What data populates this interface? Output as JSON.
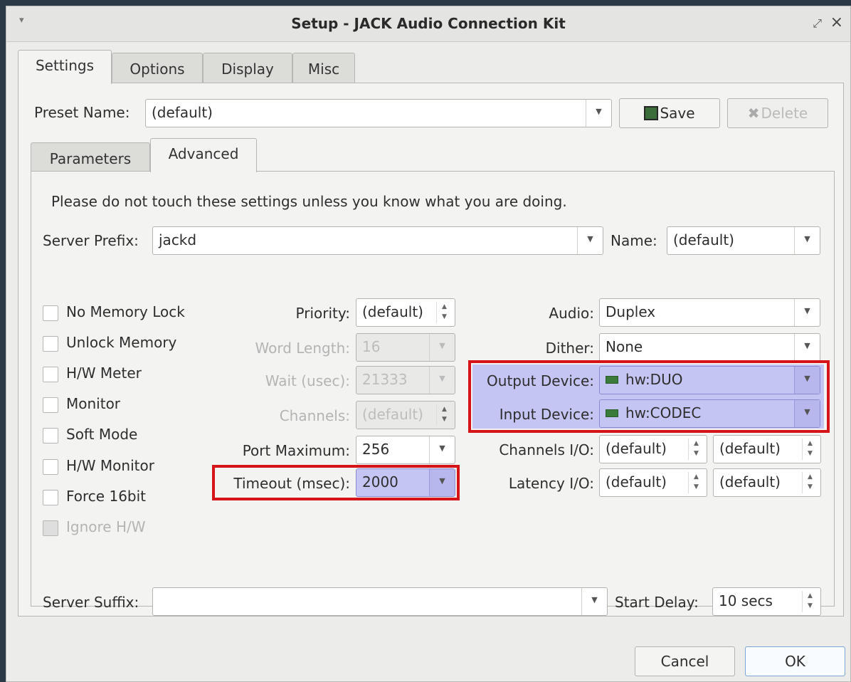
{
  "window": {
    "title": "Setup - JACK Audio Connection Kit"
  },
  "main_tabs": [
    "Settings",
    "Options",
    "Display",
    "Misc"
  ],
  "preset": {
    "label": "Preset Name:",
    "value": "(default)",
    "save_label": "Save",
    "delete_label": "Delete"
  },
  "sub_tabs": [
    "Parameters",
    "Advanced"
  ],
  "advanced": {
    "warning": "Please do not touch these settings unless you know what you are doing.",
    "server_prefix": {
      "label": "Server Prefix:",
      "value": "jackd"
    },
    "name": {
      "label": "Name:",
      "value": "(default)"
    },
    "checkboxes": [
      {
        "label": "No Memory Lock",
        "checked": false,
        "enabled": true
      },
      {
        "label": "Unlock Memory",
        "checked": false,
        "enabled": true
      },
      {
        "label": "H/W Meter",
        "checked": false,
        "enabled": true
      },
      {
        "label": "Monitor",
        "checked": false,
        "enabled": true
      },
      {
        "label": "Soft Mode",
        "checked": false,
        "enabled": true
      },
      {
        "label": "H/W Monitor",
        "checked": false,
        "enabled": true
      },
      {
        "label": "Force 16bit",
        "checked": false,
        "enabled": true
      },
      {
        "label": "Ignore H/W",
        "checked": false,
        "enabled": false
      }
    ],
    "priority": {
      "label": "Priority:",
      "value": "(default)"
    },
    "word_length": {
      "label": "Word Length:",
      "value": "16"
    },
    "wait": {
      "label": "Wait (usec):",
      "value": "21333"
    },
    "channels": {
      "label": "Channels:",
      "value": "(default)"
    },
    "port_maximum": {
      "label": "Port Maximum:",
      "value": "256"
    },
    "timeout": {
      "label": "Timeout (msec):",
      "value": "2000"
    },
    "audio": {
      "label": "Audio:",
      "value": "Duplex"
    },
    "dither": {
      "label": "Dither:",
      "value": "None"
    },
    "output_device": {
      "label": "Output Device:",
      "value": "hw:DUO"
    },
    "input_device": {
      "label": "Input Device:",
      "value": "hw:CODEC"
    },
    "channels_io": {
      "label": "Channels I/O:",
      "in": "(default)",
      "out": "(default)"
    },
    "latency_io": {
      "label": "Latency I/O:",
      "in": "(default)",
      "out": "(default)"
    },
    "server_suffix": {
      "label": "Server Suffix:",
      "value": ""
    },
    "start_delay": {
      "label": "Start Delay:",
      "value": "10 secs"
    }
  },
  "footer": {
    "cancel_label": "Cancel",
    "ok_label": "OK"
  },
  "colors": {
    "highlight": "#c5c5f3",
    "annotation_red": "#d5141a",
    "default_button": "#7aa5d6"
  }
}
